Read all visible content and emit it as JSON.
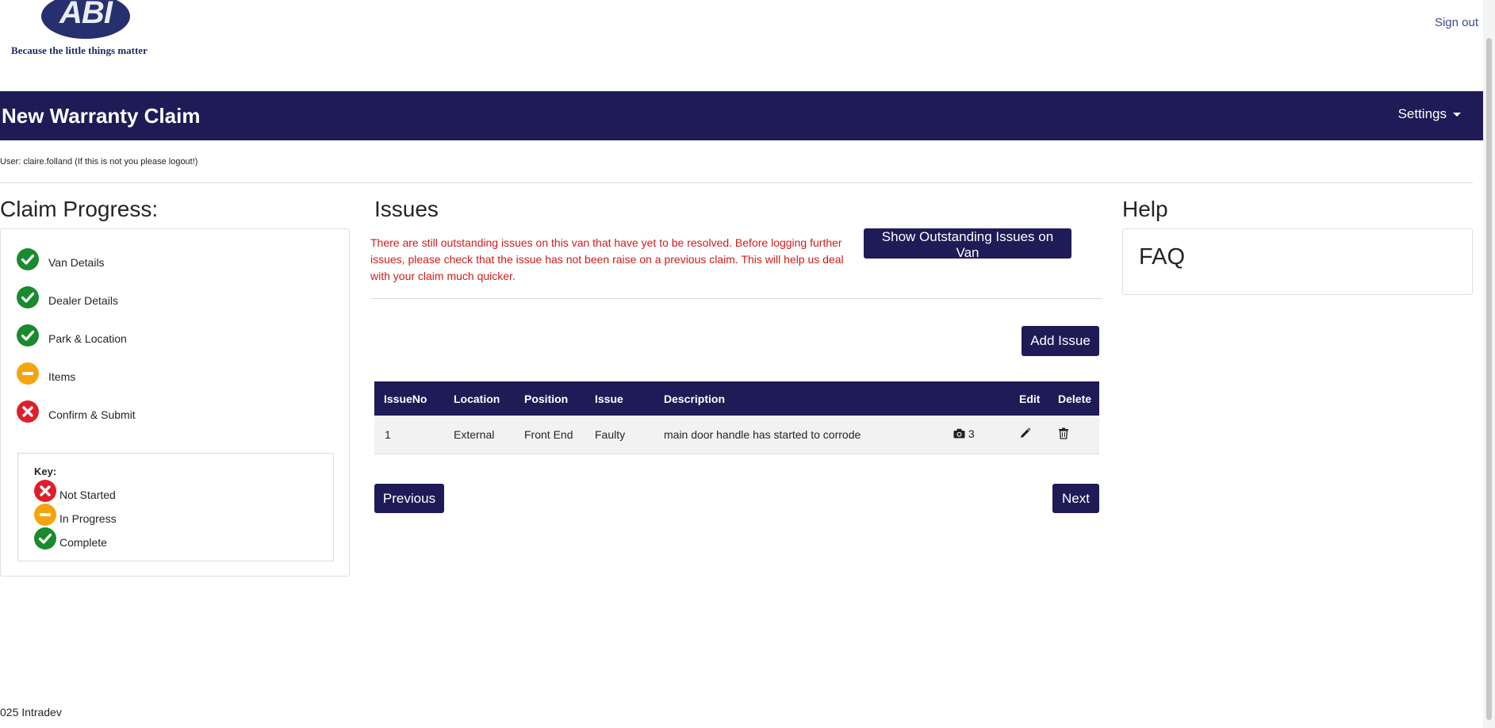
{
  "header": {
    "logo_text": "ABI",
    "tagline": "Because the little things matter",
    "sign_out": "Sign out"
  },
  "navbar": {
    "title": "New Warranty Claim",
    "settings": "Settings"
  },
  "user_line": "User: claire.folland (If this is not you please logout!)",
  "progress": {
    "title": "Claim Progress:",
    "steps": [
      {
        "label": "Van Details",
        "status": "complete"
      },
      {
        "label": "Dealer Details",
        "status": "complete"
      },
      {
        "label": "Park & Location",
        "status": "complete"
      },
      {
        "label": "Items",
        "status": "in-progress"
      },
      {
        "label": "Confirm & Submit",
        "status": "not-started"
      }
    ],
    "key": {
      "title": "Key:",
      "items": [
        {
          "label": "Not Started",
          "status": "not-started"
        },
        {
          "label": "In Progress",
          "status": "in-progress"
        },
        {
          "label": "Complete",
          "status": "complete"
        }
      ]
    }
  },
  "issues": {
    "title": "Issues",
    "warning": "There are still outstanding issues on this van that have yet to be resolved. Before logging further issues, please check that the issue has not been raise on a previous claim. This will help us deal with your claim much quicker.",
    "show_outstanding_button": "Show Outstanding Issues on Van",
    "add_issue_button": "Add Issue",
    "columns": [
      "IssueNo",
      "Location",
      "Position",
      "Issue",
      "Description",
      "Edit",
      "Delete"
    ],
    "rows": [
      {
        "issue_no": "1",
        "location": "External",
        "position": "Front End",
        "issue": "Faulty",
        "description": "main door handle has started to corrode",
        "photo_count": "3"
      }
    ],
    "previous_button": "Previous",
    "next_button": "Next"
  },
  "help": {
    "title": "Help",
    "faq": "FAQ"
  },
  "footer": "025 Intradev",
  "colors": {
    "primary": "#1e1b57",
    "complete": "#1a8a2e",
    "in_progress": "#f5a50b",
    "not_started": "#e01e2a",
    "warning_text": "#d11a1a"
  }
}
